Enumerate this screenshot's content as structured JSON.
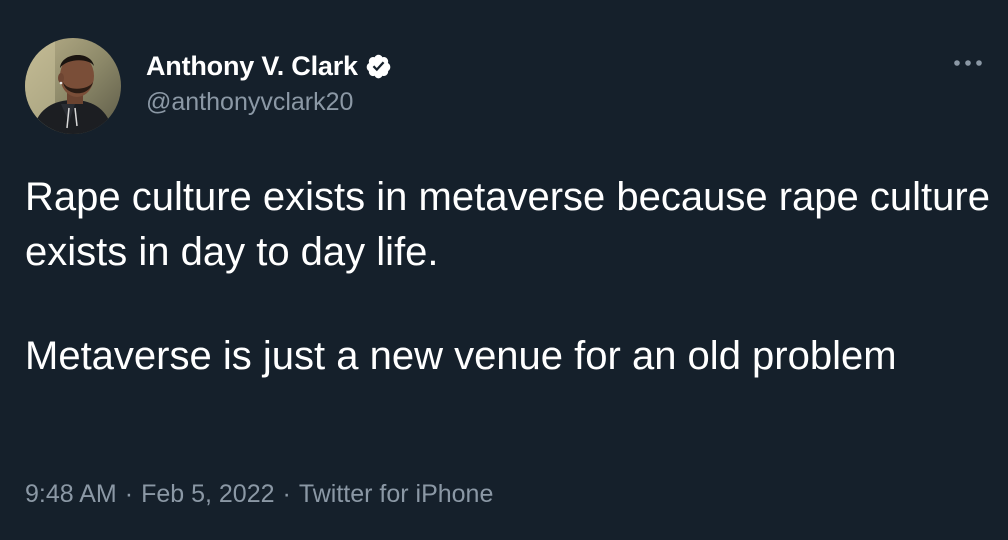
{
  "author": {
    "display_name": "Anthony V. Clark",
    "handle": "@anthonyvclark20",
    "verified": true
  },
  "tweet": {
    "paragraphs": [
      "Rape culture exists in metaverse because rape culture exists in day to day life.",
      "Metaverse is just a new venue for an old problem"
    ]
  },
  "meta": {
    "time": "9:48 AM",
    "separator": "·",
    "date": "Feb 5, 2022",
    "source": "Twitter for iPhone"
  },
  "icons": {
    "verified": "verified-badge-icon",
    "more": "more-options-icon"
  },
  "colors": {
    "background": "#15202b",
    "text_primary": "#ffffff",
    "text_secondary": "#8b98a5"
  }
}
